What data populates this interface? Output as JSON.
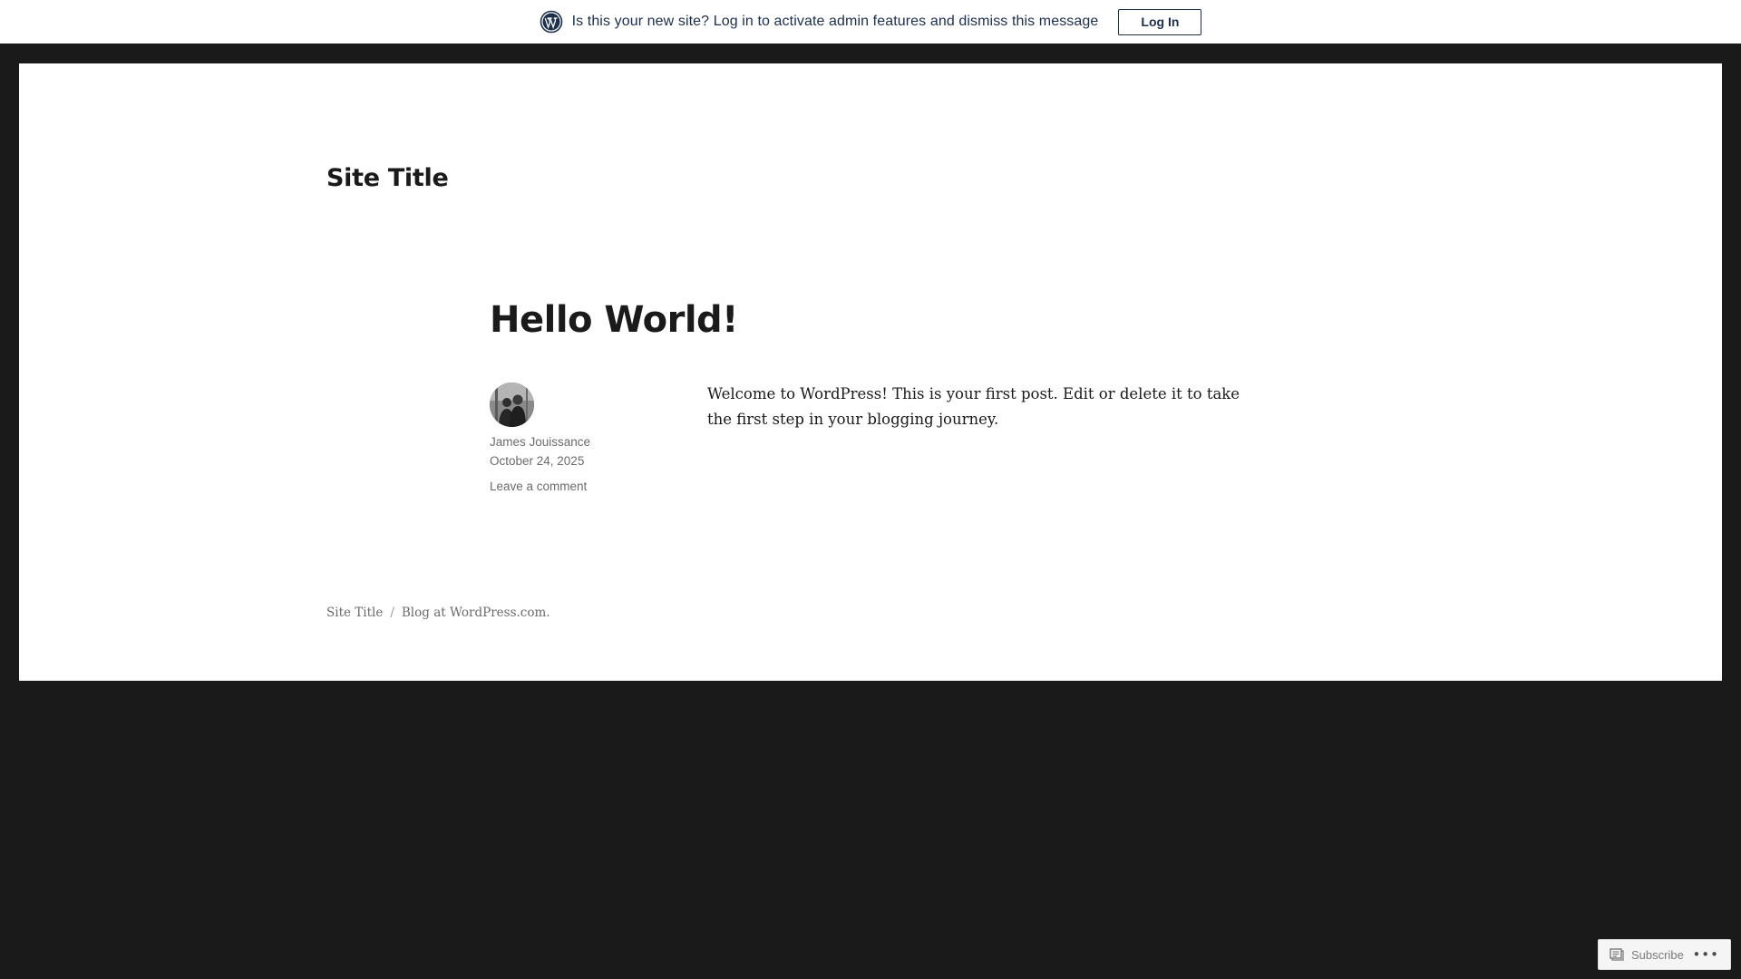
{
  "notice": {
    "message": "Is this your new site? Log in to activate admin features and dismiss this message",
    "login_label": "Log In",
    "logo_icon": "wordpress-logo-icon"
  },
  "site": {
    "title": "Site Title"
  },
  "post": {
    "title": "Hello World!",
    "author": "James Jouissance",
    "date": "October 24, 2025",
    "comment_link": "Leave a comment",
    "body": "Welcome to WordPress! This is your first post. Edit or delete it to take the first step in your blogging journey."
  },
  "footer": {
    "site_title": "Site Title",
    "separator": "/",
    "credit": "Blog at WordPress.com."
  },
  "subscribe": {
    "label": "Subscribe",
    "more": "•••"
  },
  "colors": {
    "background": "#1a1a1a",
    "page": "#ffffff",
    "notice_text": "#1d2f4a",
    "meta_text": "#6b6b6b"
  }
}
